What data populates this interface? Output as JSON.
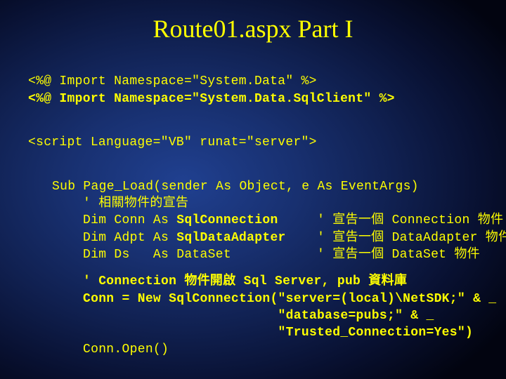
{
  "title": "Route01.aspx Part I",
  "lines": {
    "import1": "<%@ Import Namespace=\"System.Data\" %>",
    "import2": "<%@ Import Namespace=\"System.Data.SqlClient\" %>",
    "script": "<script Language=\"VB\" runat=\"server\">",
    "sub": "Sub Page_Load(sender As Object, e As EventArgs)",
    "c1": "' 相關物件的宣告",
    "d1a": "Dim Conn As ",
    "d1b": "SqlConnection",
    "d1c": "     ' 宣告一個 Connection 物件",
    "d2a": "Dim Adpt As ",
    "d2b": "SqlDataAdapter",
    "d2c": "    ' 宣告一個 DataAdapter 物件",
    "d3": "Dim Ds   As DataSet           ' 宣告一個 DataSet 物件",
    "c2": "' Connection 物件開啟 Sql Server, pub 資料庫",
    "conn1": "Conn = New SqlConnection(\"server=(local)\\NetSDK;\" & _",
    "conn2": "                         \"database=pubs;\" & _",
    "conn3": "                         \"Trusted_Connection=Yes\")",
    "open": "Conn.Open()"
  }
}
